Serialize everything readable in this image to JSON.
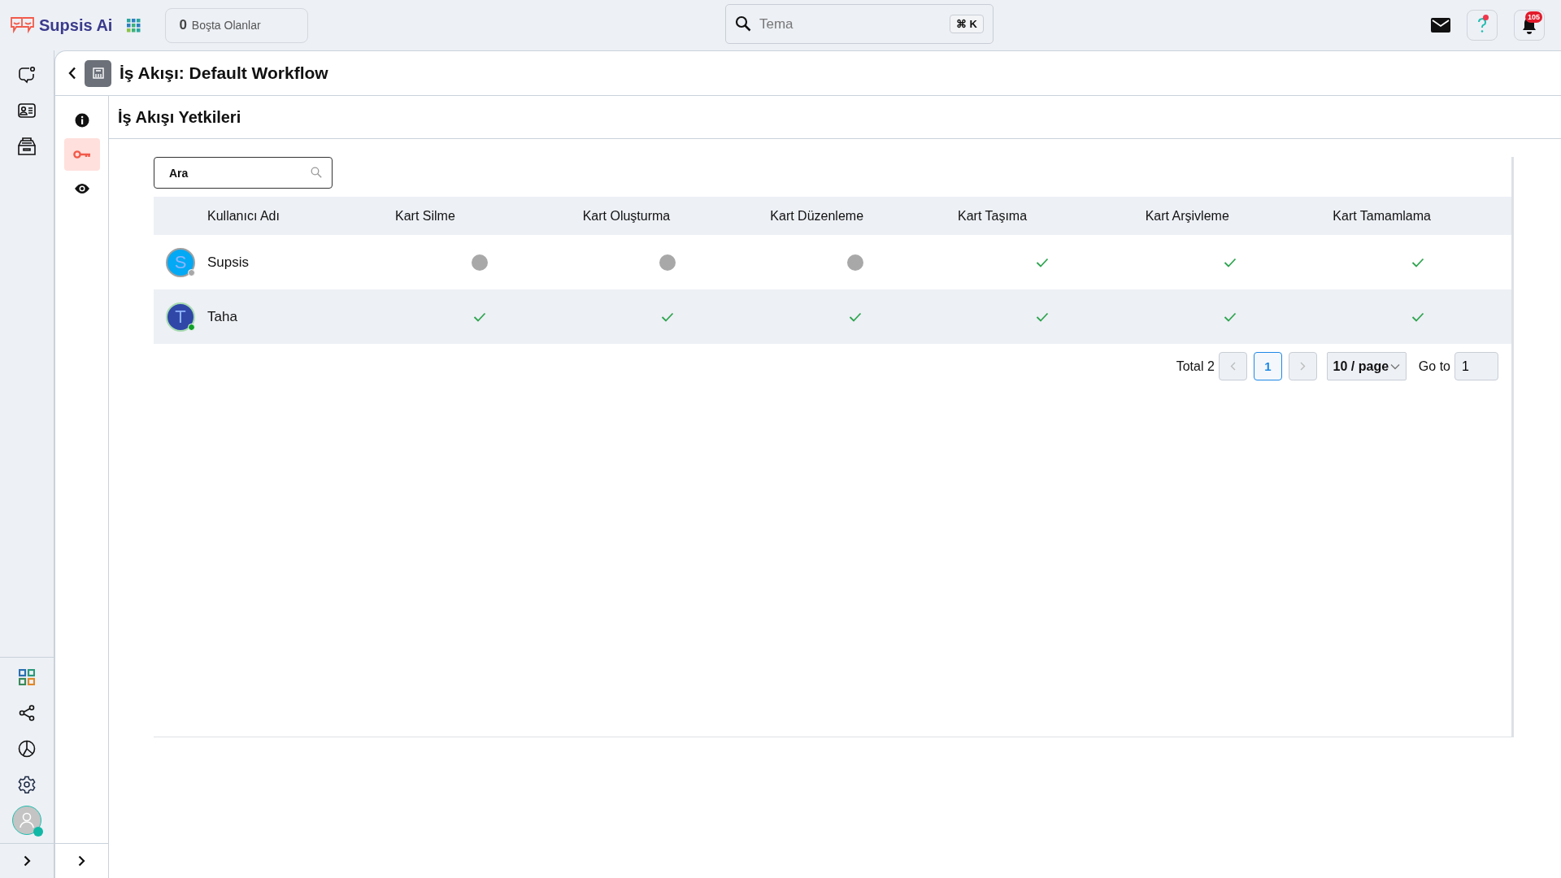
{
  "brand": {
    "name": "Supsis Ai"
  },
  "idle": {
    "count": "0",
    "label": "Boşta Olanlar"
  },
  "search": {
    "value": "Tema",
    "shortcut": "⌘ K"
  },
  "help": {
    "unread": true
  },
  "notifications": {
    "count": "105"
  },
  "user": {
    "online": true
  },
  "header": {
    "title": "İş Akışı: Default Workflow"
  },
  "tabs": [
    {
      "kind": "info",
      "selected": false
    },
    {
      "kind": "key",
      "selected": true
    },
    {
      "kind": "eye",
      "selected": false
    }
  ],
  "section": {
    "title": "İş Akışı Yetkileri"
  },
  "filter": {
    "placeholder": "Ara"
  },
  "table": {
    "columns": [
      "Kullanıcı Adı",
      "Kart Silme",
      "Kart Oluşturma",
      "Kart Düzenleme",
      "Kart Taşıma",
      "Kart Arşivleme",
      "Kart Tamamlama"
    ],
    "rows": [
      {
        "initial": "S",
        "name": "Supsis",
        "color": "#03a9f4",
        "online": false,
        "permissions": [
          false,
          false,
          false,
          true,
          true,
          true
        ]
      },
      {
        "initial": "T",
        "name": "Taha",
        "color": "#3047a8",
        "online": true,
        "permissions": [
          true,
          true,
          true,
          true,
          true,
          true
        ]
      }
    ]
  },
  "pagination": {
    "total": "Total 2",
    "pages": [
      {
        "label": "1",
        "selected": true
      }
    ],
    "page_size": "10 / page",
    "goto_label": "Go to",
    "goto_value": "1"
  }
}
